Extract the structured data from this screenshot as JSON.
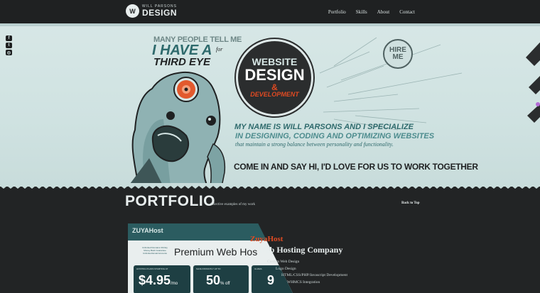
{
  "logo": {
    "top": "WILL PARSONS",
    "main": "DESIGN",
    "badge": "W"
  },
  "nav": [
    "Portfolio",
    "Skills",
    "About",
    "Contact"
  ],
  "social_icons": [
    "facebook-icon",
    "twitter-icon",
    "dribbble-icon"
  ],
  "hero": {
    "line1": "MANY PEOPLE TELL ME",
    "line2": "I HAVE A",
    "line2_for": "for",
    "line3": "THIRD EYE",
    "circle": {
      "website": "WEBSITE",
      "design": "DESIGN",
      "amp": "&",
      "dev": "DEVELOPMENT"
    },
    "hire": {
      "line1": "HIRE",
      "line2": "ME"
    },
    "intro1": "MY NAME IS WILL PARSONS AND I SPECIALIZE",
    "intro2": "IN DESIGNING, CODING AND OPTIMIZING WEBSITES",
    "intro3": "that maintain a strong balance between personality and functionality.",
    "cta": "COME IN AND SAY HI, I'D LOVE FOR US TO WORK TOGETHER"
  },
  "portfolio": {
    "title": "PORTFOLIO",
    "subtitle": "Selective examples of my work",
    "back_to_top": "Back to Top",
    "item": {
      "name": "ZuyaHost",
      "tagline": "Web Hosting Company",
      "services": [
        "Custom Web Design",
        "Logo Design",
        "HTML/CSS/PHP/Javascript Development",
        "WHMCS Integration"
      ],
      "thumb": {
        "logo": "ZUYAHost",
        "small": "Unlimited Domains 30-Day Money Back Guarantee Unlimited Email Accounts",
        "headline": "Premium Web Hos",
        "box1_label": "HOSTING PLANS STARTING AT",
        "box1_value": "$4.95",
        "box1_unit": "/mo",
        "box2_label": "SAVE INSTANTLY UP TO",
        "box2_value": "50",
        "box2_unit": "% off",
        "box3_label": "GUARA",
        "box3_value": "9"
      }
    }
  }
}
